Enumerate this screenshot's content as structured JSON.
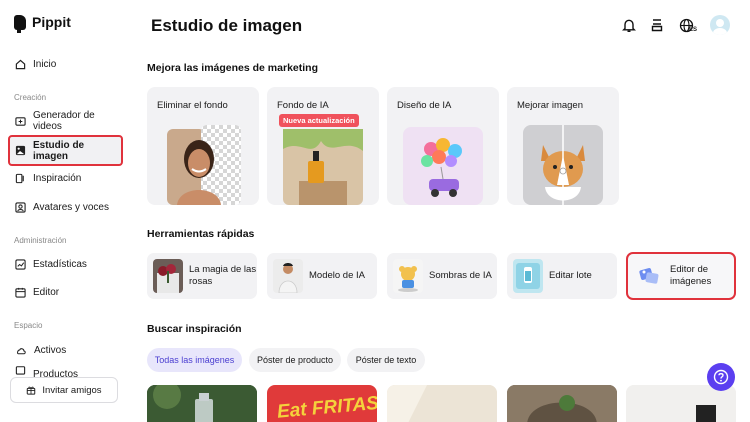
{
  "brand": {
    "name": "Pippit"
  },
  "sidebar": {
    "items": [
      {
        "label": "Inicio"
      },
      {
        "label": "Generador de videos"
      },
      {
        "label": "Estudio de imagen"
      },
      {
        "label": "Inspiración"
      },
      {
        "label": "Avatares y voces"
      },
      {
        "label": "Estadísticas"
      },
      {
        "label": "Editor"
      },
      {
        "label": "Activos"
      },
      {
        "label": "Productos"
      }
    ],
    "sections": [
      "Creación",
      "Administración",
      "Espacio"
    ],
    "invite_label": "Invitar amigos"
  },
  "header": {
    "title": "Estudio de imagen",
    "lang": "ES"
  },
  "marketing": {
    "title": "Mejora las imágenes de marketing",
    "cards": [
      {
        "label": "Eliminar el fondo"
      },
      {
        "label": "Fondo de IA",
        "badge": "Nueva actualización"
      },
      {
        "label": "Diseño de IA"
      },
      {
        "label": "Mejorar imagen"
      }
    ]
  },
  "quick_tools": {
    "title": "Herramientas rápidas",
    "items": [
      {
        "label": "La magia de las rosas"
      },
      {
        "label": "Modelo de IA"
      },
      {
        "label": "Sombras de IA"
      },
      {
        "label": "Editar lote"
      },
      {
        "label": "Editor de imágenes"
      }
    ]
  },
  "inspiration": {
    "title": "Buscar inspiración",
    "chips": [
      {
        "label": "Todas las imágenes",
        "active": true
      },
      {
        "label": "Póster de producto"
      },
      {
        "label": "Póster de texto"
      }
    ],
    "poster_text": "Eat FRITAS!"
  },
  "colors": {
    "accent": "#5b3ff0",
    "highlight_border": "#e0323c",
    "badge": "#f0525c"
  }
}
